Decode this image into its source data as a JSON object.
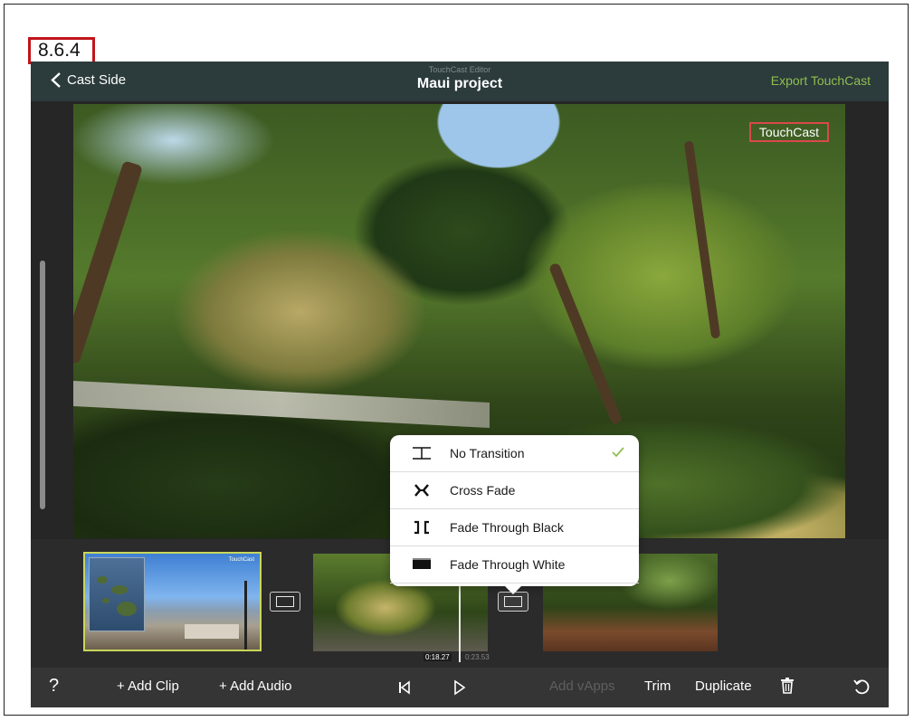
{
  "step_label": "8.6.4",
  "header": {
    "back_label": "Cast Side",
    "subtitle": "TouchCast Editor",
    "title": "Maui project",
    "export_label": "Export TouchCast"
  },
  "video": {
    "watermark": "TouchCast"
  },
  "timeline": {
    "current_time": "0:18.27",
    "total_time": "0:23.53",
    "clip1_tag": "TouchCast"
  },
  "transition_menu": {
    "options": [
      {
        "label": "No Transition",
        "icon": "no-transition-icon",
        "selected": true
      },
      {
        "label": "Cross Fade",
        "icon": "cross-fade-icon",
        "selected": false
      },
      {
        "label": "Fade Through Black",
        "icon": "fade-black-icon",
        "selected": false
      },
      {
        "label": "Fade Through White",
        "icon": "fade-white-icon",
        "selected": false
      }
    ]
  },
  "toolbar": {
    "help_label": "?",
    "add_clip_label": "+ Add Clip",
    "add_audio_label": "+ Add Audio",
    "add_vapps_label": "Add vApps",
    "trim_label": "Trim",
    "duplicate_label": "Duplicate"
  },
  "colors": {
    "accent_green": "#8fbf4f",
    "header_bg": "#2c3b3c",
    "badge_red": "#c0151b",
    "selected_clip_border": "#c8d65a"
  }
}
